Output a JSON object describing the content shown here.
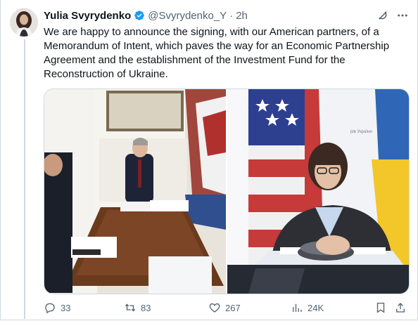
{
  "tweet": {
    "author_name": "Yulia Svyrydenko",
    "handle": "@Svyrydenko_Y",
    "separator": "·",
    "time": "2h",
    "text": "We are happy to announce the signing, with our American partners, of a Memorandum of Intent, which paves the way for an Economic Partnership Agreement and the establishment of the Investment Fund for the Reconstruction of Ukraine."
  },
  "actions": {
    "replies": "33",
    "reposts": "83",
    "likes": "267",
    "views": "24K"
  },
  "colors": {
    "text": "#0f1419",
    "muted": "#536471",
    "verified": "#1d9bf0",
    "border": "#cfd9de"
  },
  "icons": [
    "grok-icon",
    "more-icon",
    "verified-badge-icon",
    "reply-icon",
    "repost-icon",
    "like-icon",
    "views-icon",
    "bookmark-icon",
    "share-icon"
  ]
}
